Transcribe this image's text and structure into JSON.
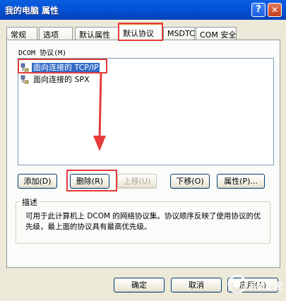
{
  "window": {
    "title": "我的电脑 属性",
    "help_label": "?",
    "close_label": "✕"
  },
  "tabs": [
    {
      "label": "常规"
    },
    {
      "label": "选项"
    },
    {
      "label": "默认属性"
    },
    {
      "label": "默认协议",
      "active": true
    },
    {
      "label": "MSDTC"
    },
    {
      "label": "COM 安全"
    }
  ],
  "protocols": {
    "label": "DCOM 协议(M)",
    "items": [
      {
        "label": "面向连接的 TCP/IP",
        "selected": true
      },
      {
        "label": "面向连接的 SPX",
        "selected": false
      }
    ]
  },
  "buttons": {
    "add": "添加(D)",
    "remove": "删除(R)",
    "move_up": "上移(U)",
    "move_down": "下移(O)",
    "properties": "属性(P)..."
  },
  "description": {
    "title": "描述",
    "text": "可用于此计算机上 DCOM 的网络协议集。协议顺序反映了使用协议的优先级，最上面的协议具有最高优先级。"
  },
  "footer": {
    "ok": "确定",
    "cancel": "取消",
    "apply": "应用(A)"
  },
  "watermark": {
    "text": "系统之家"
  },
  "colors": {
    "highlight": "#316ac5",
    "annotation_red": "#e53b3b",
    "titlebar_blue": "#0553d8"
  }
}
